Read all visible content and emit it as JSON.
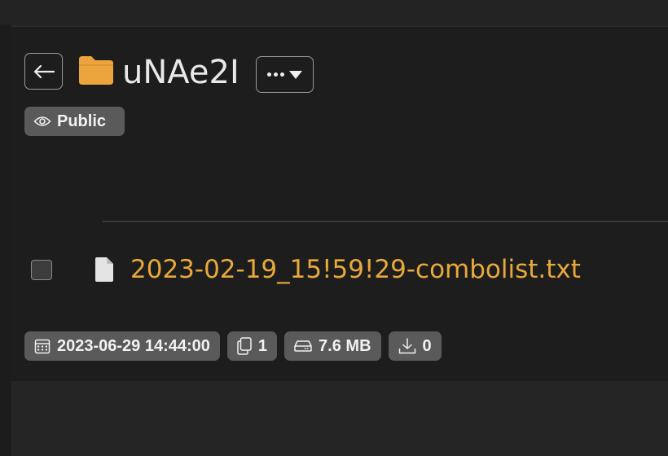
{
  "folder": {
    "name": "uNAe2I",
    "visibility_label": "Public"
  },
  "file": {
    "name": "2023-02-19_15!59!29-combolist.txt"
  },
  "meta": {
    "date": "2023-06-29 14:44:00",
    "file_count": "1",
    "size": "7.6 MB",
    "downloads": "0"
  },
  "colors": {
    "accent": "#e8a93a",
    "badge_bg": "#5a5a5a",
    "background": "#1d1d1d"
  },
  "icons": {
    "back": "arrow-left-icon",
    "folder": "folder-icon",
    "more": "more-dots-icon",
    "visibility": "eye-icon",
    "file": "file-icon",
    "date": "calendar-icon",
    "count": "copy-icon",
    "size": "hard-drive-icon",
    "downloads": "download-icon"
  }
}
